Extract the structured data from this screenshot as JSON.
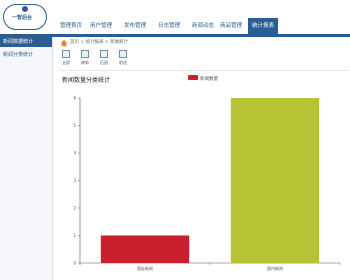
{
  "header": {
    "logo_text": "一智后台",
    "nav": [
      {
        "label": "管理首页"
      },
      {
        "label": "用户管理"
      },
      {
        "label": "发布管理"
      },
      {
        "label": "日志管理"
      },
      {
        "label": "新闻动态"
      },
      {
        "label": "商品管理"
      },
      {
        "label": "统计报表"
      }
    ],
    "active_nav_index": 6,
    "brand_color": "#2a5d94"
  },
  "sidebar": {
    "items": [
      {
        "label": "新闻数据统计"
      },
      {
        "label": "新闻分类统计"
      }
    ],
    "active_index": 0
  },
  "breadcrumb": {
    "text": "首页 > 统计报表 > 新闻统计"
  },
  "toolbar": {
    "items": [
      {
        "label": "全部",
        "icon": "grid-icon"
      },
      {
        "label": "刷新",
        "icon": "refresh-icon"
      },
      {
        "label": "后退",
        "icon": "back-icon"
      },
      {
        "label": "前进",
        "icon": "forward-icon"
      }
    ]
  },
  "chart_data": {
    "type": "bar",
    "title": "新闻数量分类统计",
    "categories": [
      "国际新闻",
      "国内新闻"
    ],
    "series": [
      {
        "name": "新闻数量",
        "values": [
          1,
          6
        ]
      }
    ],
    "colors": [
      "#c9202e",
      "#b5c334"
    ],
    "ylim": [
      0,
      6
    ],
    "yticks": [
      0,
      1,
      2,
      3,
      4,
      5,
      6
    ],
    "grid": false,
    "legend_position": "top-right"
  }
}
